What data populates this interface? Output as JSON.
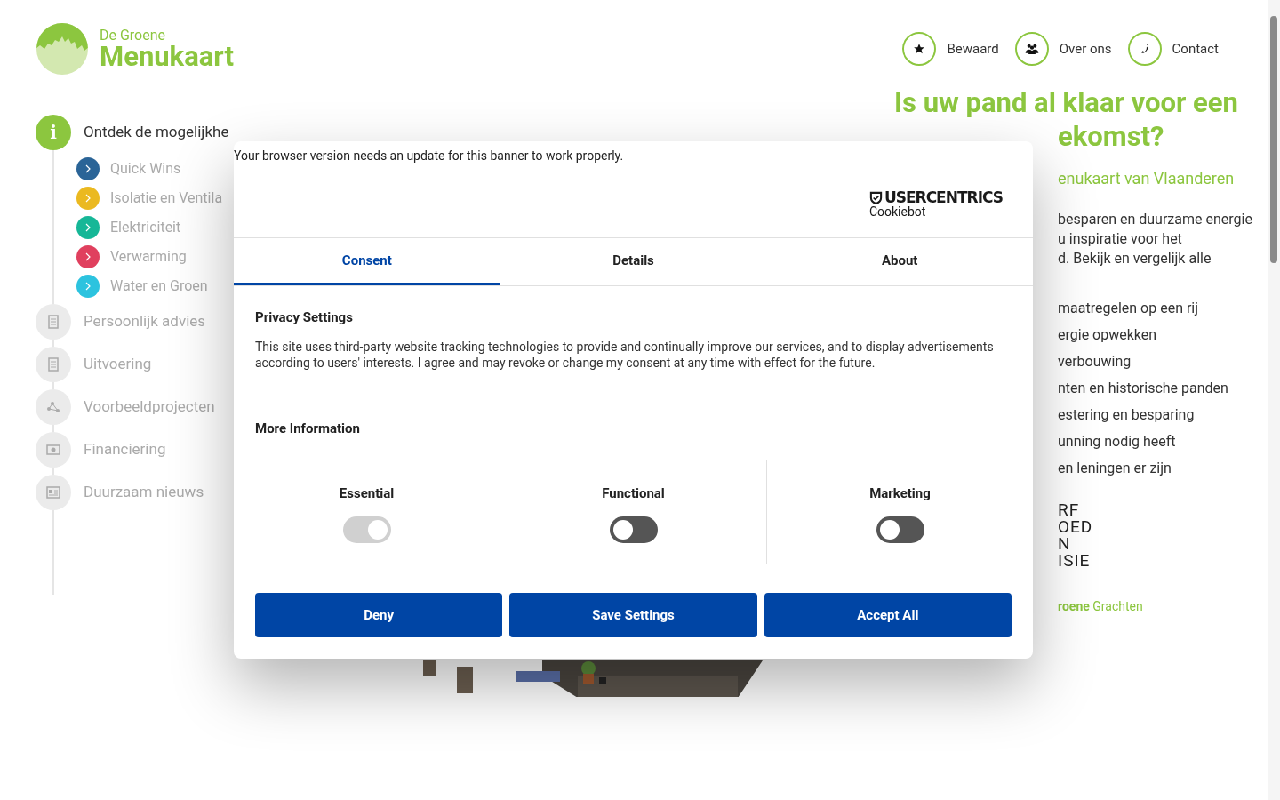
{
  "logo": {
    "small": "De Groene",
    "large": "Menukaart"
  },
  "nav": [
    {
      "label": "Bewaard",
      "kind": "star"
    },
    {
      "label": "Over ons",
      "kind": "people"
    },
    {
      "label": "Contact",
      "kind": "phone"
    }
  ],
  "sidebar": {
    "items": [
      {
        "label": "Ontdek de mogelijkhe",
        "kind": "info",
        "icon": "i",
        "selected": true,
        "children": [
          {
            "label": "Quick Wins",
            "color": "#2a6497"
          },
          {
            "label": "Isolatie en Ventila",
            "color": "#ebb920"
          },
          {
            "label": "Elektriciteit",
            "color": "#16b797"
          },
          {
            "label": "Verwarming",
            "color": "#e0405e"
          },
          {
            "label": "Water en Groen",
            "color": "#2cc3df"
          }
        ]
      },
      {
        "label": "Persoonlijk advies",
        "kind": "doc",
        "selected": false
      },
      {
        "label": "Uitvoering",
        "kind": "doc",
        "selected": false
      },
      {
        "label": "Voorbeeldprojecten",
        "kind": "nodes",
        "selected": false
      },
      {
        "label": "Financiering",
        "kind": "money",
        "selected": false
      },
      {
        "label": "Duurzaam nieuws",
        "kind": "news",
        "selected": false
      }
    ]
  },
  "content": {
    "heading": [
      "Is uw pand al klaar voor een",
      "ekomst?"
    ],
    "subtitle": "enukaart van Vlaanderen",
    "paragraph": [
      "besparen en duurzame energie",
      "u inspiratie voor het",
      "d. Bekijk en vergelijk alle"
    ],
    "list": [
      "maatregelen op een rij",
      "ergie opwekken",
      "verbouwing",
      "nten en historische panden",
      "estering en besparing",
      "unning nodig heeft",
      "en leningen er zijn"
    ],
    "partner_logo": [
      "RF",
      "OED",
      "N",
      "ISIE"
    ],
    "partner_logo_2": "**roene** Grachten"
  },
  "cookie_dialog": {
    "notice": "Your browser version needs an update for this banner to work properly.",
    "brand": "USERCENTRICS",
    "brand_sub": "Cookiebot",
    "tabs": [
      {
        "label": "Consent",
        "selected": true
      },
      {
        "label": "Details",
        "selected": false
      },
      {
        "label": "About",
        "selected": false
      }
    ],
    "heading": "Privacy Settings",
    "text": "This site uses third-party website tracking technologies to provide and continually improve our services, and to display advertisements according to users' interests. I agree and may revoke or change my consent at any time with effect for the future.",
    "more": "More Information",
    "categories": [
      {
        "label": "Essential",
        "on": true,
        "disabled": true
      },
      {
        "label": "Functional",
        "on": false,
        "disabled": false
      },
      {
        "label": "Marketing",
        "on": false,
        "disabled": false
      }
    ],
    "buttons": [
      "Deny",
      "Save Settings",
      "Accept All"
    ]
  }
}
